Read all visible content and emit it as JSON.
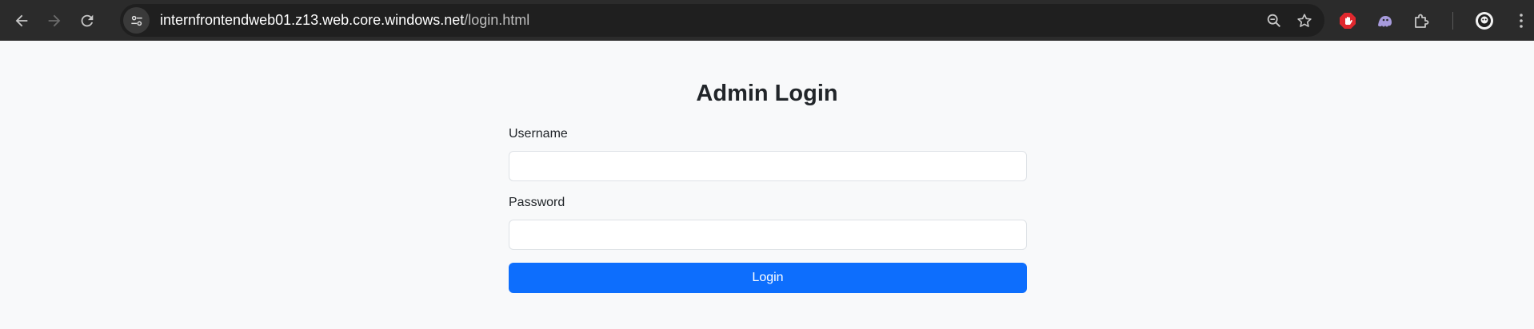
{
  "browser": {
    "url_host": "internfrontendweb01.z13.web.core.windows.net",
    "url_path": "/login.html"
  },
  "page": {
    "title": "Admin Login",
    "username_label": "Username",
    "username_value": "",
    "password_label": "Password",
    "password_value": "",
    "login_button": "Login"
  },
  "colors": {
    "toolbar_bg": "#2b2b2b",
    "page_bg": "#f8f9fa",
    "primary": "#0d6efd"
  }
}
